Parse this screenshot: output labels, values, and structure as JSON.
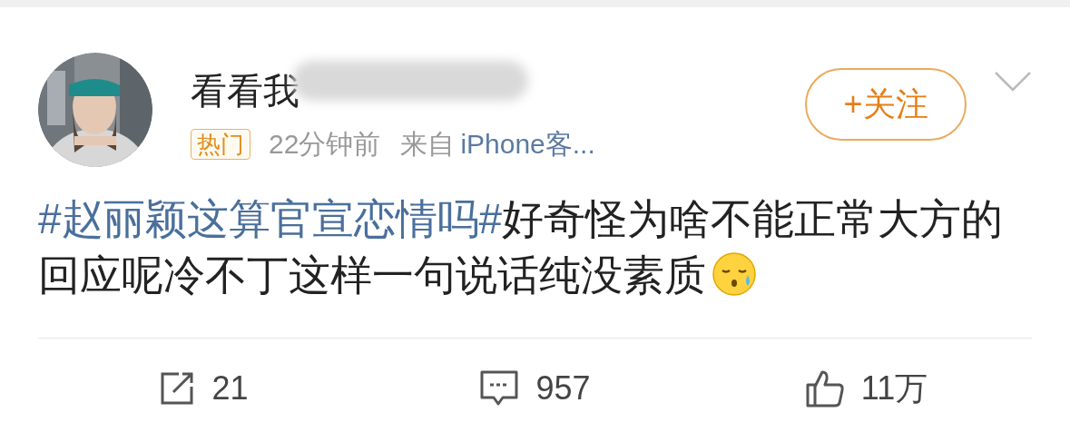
{
  "post": {
    "author": "看看我",
    "badge": "热门",
    "time": "22分钟前",
    "source_prefix": "来自",
    "source": "iPhone客...",
    "follow_button": "+关注",
    "hashtag": "#赵丽颖这算官宣恋情吗#",
    "text": "好奇怪为啥不能正常大方的回应呢冷不丁这样一句说话纯没素质"
  },
  "actions": [
    {
      "kind": "repost",
      "count": "21"
    },
    {
      "kind": "comment",
      "count": "957"
    },
    {
      "kind": "like",
      "count": "11万"
    }
  ]
}
